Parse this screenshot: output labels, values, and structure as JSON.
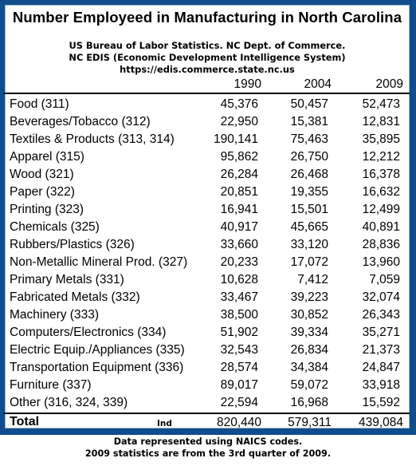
{
  "title": "Number Employeed in Manufacturing in North Carolina",
  "source_lines": [
    "US Bureau of Labor Statistics. NC Dept. of Commerce.",
    "NC EDIS (Economic Development Intelligence System)",
    "https://edis.commerce.state.nc.us"
  ],
  "colors": {
    "frame": "#0f4d8c",
    "panel": "#ffffff"
  },
  "table": {
    "columns": [
      "1990",
      "2004",
      "2009"
    ],
    "rows": [
      {
        "label": "Food (311)",
        "values": [
          "45,376",
          "50,457",
          "52,473"
        ]
      },
      {
        "label": "Beverages/Tobacco (312)",
        "values": [
          "22,950",
          "15,381",
          "12,831"
        ]
      },
      {
        "label": "Textiles & Products (313, 314)",
        "values": [
          "190,141",
          "75,463",
          "35,895"
        ]
      },
      {
        "label": "Apparel (315)",
        "values": [
          "95,862",
          "26,750",
          "12,212"
        ]
      },
      {
        "label": "Wood (321)",
        "values": [
          "26,284",
          "26,468",
          "16,378"
        ]
      },
      {
        "label": "Paper (322)",
        "values": [
          "20,851",
          "19,355",
          "16,632"
        ]
      },
      {
        "label": "Printing (323)",
        "values": [
          "16,941",
          "15,501",
          "12,499"
        ]
      },
      {
        "label": "Chemicals (325)",
        "values": [
          "40,917",
          "45,665",
          "40,891"
        ]
      },
      {
        "label": "Rubbers/Plastics (326)",
        "values": [
          "33,660",
          "33,120",
          "28,836"
        ]
      },
      {
        "label": "Non-Metallic Mineral Prod. (327)",
        "values": [
          "20,233",
          "17,072",
          "13,960"
        ]
      },
      {
        "label": "Primary Metals (331)",
        "values": [
          "10,628",
          "7,412",
          "7,059"
        ]
      },
      {
        "label": "Fabricated Metals (332)",
        "values": [
          "33,467",
          "39,223",
          "32,074"
        ]
      },
      {
        "label": "Machinery (333)",
        "values": [
          "38,500",
          "30,852",
          "26,343"
        ]
      },
      {
        "label": "Computers/Electronics (334)",
        "values": [
          "51,902",
          "39,334",
          "35,271"
        ]
      },
      {
        "label": "Electric Equip./Appliances (335)",
        "values": [
          "32,543",
          "26,834",
          "21,373"
        ]
      },
      {
        "label": "Transportation Equipment (336)",
        "values": [
          "28,574",
          "34,384",
          "24,847"
        ]
      },
      {
        "label": "Furniture (337)",
        "values": [
          "89,017",
          "59,072",
          "33,918"
        ]
      },
      {
        "label": "Other (316, 324, 339)",
        "values": [
          "22,594",
          "16,968",
          "15,592"
        ]
      }
    ],
    "total": {
      "label": "Total",
      "tag": "Ind",
      "values": [
        "820,440",
        "579,311",
        "439,084"
      ]
    }
  },
  "notes": [
    "Data represented using NAICS codes.",
    "2009 statistics are from the 3rd quarter of 2009."
  ]
}
